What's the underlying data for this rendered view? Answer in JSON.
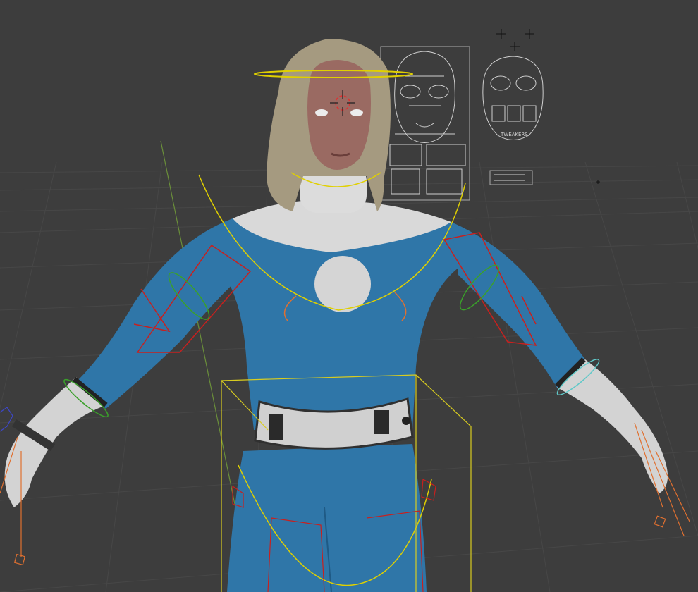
{
  "viewport": {
    "background": "#3d3d3d",
    "grid_color": "#474747",
    "axis_y_color": "#6a8f3a"
  },
  "face_picker": {
    "tweakers_label": "TWEAKERS",
    "line_color": "#cfcfcf"
  },
  "character": {
    "suit_color": "#2f76a8",
    "collar_color": "#d9d9d9",
    "skin_color": "#9a6a62",
    "hair_color": "#a59a80"
  },
  "rig": {
    "head_ring_color": "#e0d000",
    "ik_color": "#c8201e",
    "fk_color": "#3aa02a",
    "bbox_color": "#d8cc20",
    "hand_color": "#e07030",
    "cursor_color": "#e03030",
    "cyan_color": "#60c8c8"
  },
  "icons": {
    "cursor": "3d-cursor-icon",
    "move": "move-cross-icon"
  }
}
